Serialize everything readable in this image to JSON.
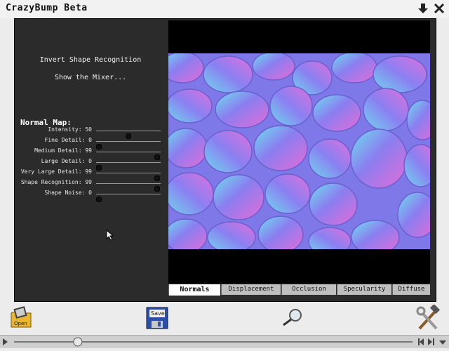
{
  "window": {
    "title": "CrazyBump Beta"
  },
  "menu": {
    "invert_label": "Invert Shape Recognition",
    "mixer_label": "Show the Mixer..."
  },
  "normal_map": {
    "title": "Normal Map:",
    "sliders": [
      {
        "label": "Intensity:",
        "value": "50",
        "level": 0.5
      },
      {
        "label": "Fine Detail:",
        "value": "0",
        "level": 0.0
      },
      {
        "label": "Medium Detail:",
        "value": "99",
        "level": 0.99
      },
      {
        "label": "Large Detail:",
        "value": "0",
        "level": 0.0
      },
      {
        "label": "Very Large Detail:",
        "value": "99",
        "level": 0.99
      },
      {
        "label": "Shape Recognition:",
        "value": "99",
        "level": 0.99
      },
      {
        "label": "Shape Noise:",
        "value": "0",
        "level": 0.0
      }
    ]
  },
  "tabs": [
    {
      "label": "Normals",
      "active": true
    },
    {
      "label": "Displacement",
      "active": false
    },
    {
      "label": "Occlusion",
      "active": false
    },
    {
      "label": "Specularity",
      "active": false
    },
    {
      "label": "Diffuse",
      "active": false
    }
  ],
  "toolbar": {
    "open_label": "Open",
    "save_label": "Save"
  },
  "scrollbar": {
    "position": 0.16
  },
  "colors": {
    "panel": "#2b2b2b",
    "preview_base": "#8a7ef0",
    "accent_pink": "#e66cd8",
    "accent_cyan": "#66e0e8"
  },
  "icons": [
    "download-arrow-icon",
    "close-icon",
    "open-icon",
    "save-disk-icon",
    "magnifier-icon",
    "tools-icon"
  ]
}
